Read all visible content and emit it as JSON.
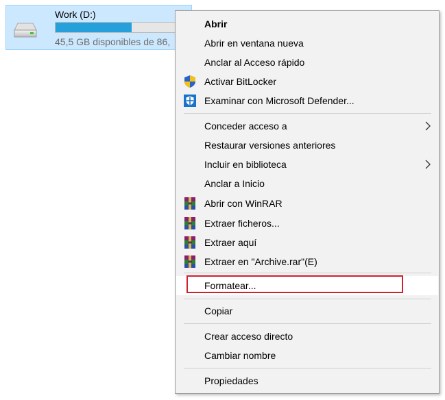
{
  "drive": {
    "name": "Work (D:)",
    "space_text": "45,5 GB disponibles de 86,",
    "used_fraction": 0.57,
    "bar_color": "#26a0da"
  },
  "menu": {
    "items": {
      "open": "Abrir",
      "open_new_window": "Abrir en ventana nueva",
      "pin_quick_access": "Anclar al Acceso rápido",
      "bitlocker": "Activar BitLocker",
      "defender": "Examinar con Microsoft Defender...",
      "give_access": "Conceder acceso a",
      "restore_versions": "Restaurar versiones anteriores",
      "include_library": "Incluir en biblioteca",
      "pin_start": "Anclar a Inicio",
      "open_winrar": "Abrir con WinRAR",
      "extract_files": "Extraer ficheros...",
      "extract_here": "Extraer aquí",
      "extract_archive": "Extraer en \"Archive.rar\"(E)",
      "format": "Formatear...",
      "copy": "Copiar",
      "create_shortcut": "Crear acceso directo",
      "rename": "Cambiar nombre",
      "properties": "Propiedades"
    },
    "icons": {
      "bitlocker": "uac-shield-icon",
      "defender": "defender-shield-icon",
      "winrar": "winrar-icon",
      "submenu": "chevron-right-icon"
    },
    "highlight_color": "#d0202e"
  }
}
